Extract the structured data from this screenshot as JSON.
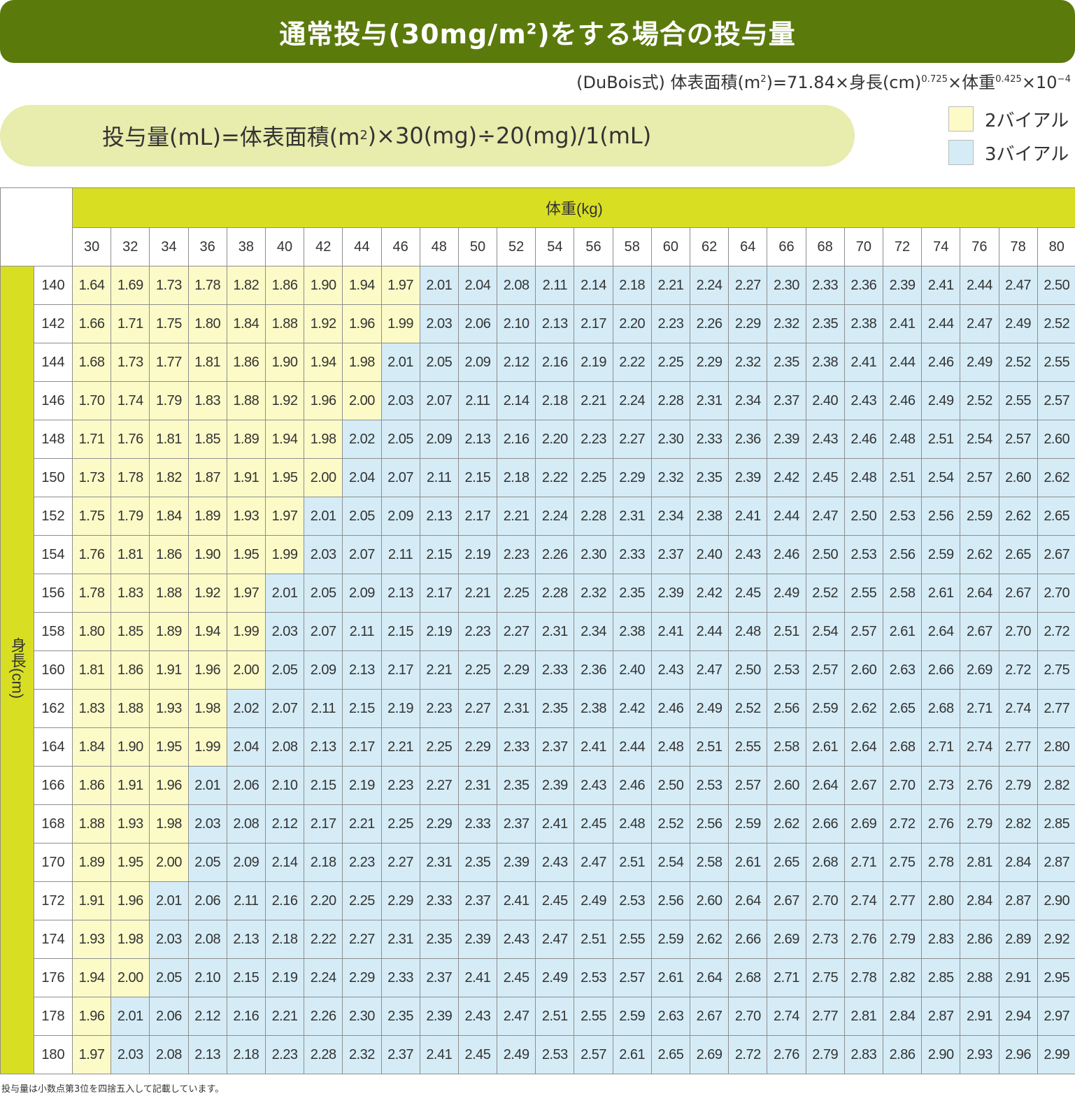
{
  "title": {
    "main": "通常投与(30mg/m",
    "sup": "2",
    "rest": ")をする場合の投与量"
  },
  "dubois": {
    "a": "(DuBois式) 体表面積(m",
    "a_sup": "2",
    "b": ")=71.84×身長(cm)",
    "b_sup": "0.725",
    "c": "×体重",
    "c_sup": "0.425",
    "d": "×10",
    "d_sup": "−4"
  },
  "formula": {
    "a": "投与量(mL)=体表面積(m",
    "a_sup": "2",
    "b": ")×30(mg)÷20(mg)/1(mL)"
  },
  "legend": [
    {
      "label": "2バイアル",
      "color": "#fcfbc8"
    },
    {
      "label": "3バイアル",
      "color": "#d5ecf6"
    }
  ],
  "table": {
    "weight_header": "体重(kg)",
    "height_header": "身長(cm)",
    "weights": [
      "30",
      "32",
      "34",
      "36",
      "38",
      "40",
      "42",
      "44",
      "46",
      "48",
      "50",
      "52",
      "54",
      "56",
      "58",
      "60",
      "62",
      "64",
      "66",
      "68",
      "70",
      "72",
      "74",
      "76",
      "78",
      "80"
    ],
    "heights": [
      "140",
      "142",
      "144",
      "146",
      "148",
      "150",
      "152",
      "154",
      "156",
      "158",
      "160",
      "162",
      "164",
      "166",
      "168",
      "170",
      "172",
      "174",
      "176",
      "178",
      "180"
    ],
    "values": [
      [
        "1.64",
        "1.69",
        "1.73",
        "1.78",
        "1.82",
        "1.86",
        "1.90",
        "1.94",
        "1.97",
        "2.01",
        "2.04",
        "2.08",
        "2.11",
        "2.14",
        "2.18",
        "2.21",
        "2.24",
        "2.27",
        "2.30",
        "2.33",
        "2.36",
        "2.39",
        "2.41",
        "2.44",
        "2.47",
        "2.50"
      ],
      [
        "1.66",
        "1.71",
        "1.75",
        "1.80",
        "1.84",
        "1.88",
        "1.92",
        "1.96",
        "1.99",
        "2.03",
        "2.06",
        "2.10",
        "2.13",
        "2.17",
        "2.20",
        "2.23",
        "2.26",
        "2.29",
        "2.32",
        "2.35",
        "2.38",
        "2.41",
        "2.44",
        "2.47",
        "2.49",
        "2.52"
      ],
      [
        "1.68",
        "1.73",
        "1.77",
        "1.81",
        "1.86",
        "1.90",
        "1.94",
        "1.98",
        "2.01",
        "2.05",
        "2.09",
        "2.12",
        "2.16",
        "2.19",
        "2.22",
        "2.25",
        "2.29",
        "2.32",
        "2.35",
        "2.38",
        "2.41",
        "2.44",
        "2.46",
        "2.49",
        "2.52",
        "2.55"
      ],
      [
        "1.70",
        "1.74",
        "1.79",
        "1.83",
        "1.88",
        "1.92",
        "1.96",
        "2.00",
        "2.03",
        "2.07",
        "2.11",
        "2.14",
        "2.18",
        "2.21",
        "2.24",
        "2.28",
        "2.31",
        "2.34",
        "2.37",
        "2.40",
        "2.43",
        "2.46",
        "2.49",
        "2.52",
        "2.55",
        "2.57"
      ],
      [
        "1.71",
        "1.76",
        "1.81",
        "1.85",
        "1.89",
        "1.94",
        "1.98",
        "2.02",
        "2.05",
        "2.09",
        "2.13",
        "2.16",
        "2.20",
        "2.23",
        "2.27",
        "2.30",
        "2.33",
        "2.36",
        "2.39",
        "2.43",
        "2.46",
        "2.48",
        "2.51",
        "2.54",
        "2.57",
        "2.60"
      ],
      [
        "1.73",
        "1.78",
        "1.82",
        "1.87",
        "1.91",
        "1.95",
        "2.00",
        "2.04",
        "2.07",
        "2.11",
        "2.15",
        "2.18",
        "2.22",
        "2.25",
        "2.29",
        "2.32",
        "2.35",
        "2.39",
        "2.42",
        "2.45",
        "2.48",
        "2.51",
        "2.54",
        "2.57",
        "2.60",
        "2.62"
      ],
      [
        "1.75",
        "1.79",
        "1.84",
        "1.89",
        "1.93",
        "1.97",
        "2.01",
        "2.05",
        "2.09",
        "2.13",
        "2.17",
        "2.21",
        "2.24",
        "2.28",
        "2.31",
        "2.34",
        "2.38",
        "2.41",
        "2.44",
        "2.47",
        "2.50",
        "2.53",
        "2.56",
        "2.59",
        "2.62",
        "2.65"
      ],
      [
        "1.76",
        "1.81",
        "1.86",
        "1.90",
        "1.95",
        "1.99",
        "2.03",
        "2.07",
        "2.11",
        "2.15",
        "2.19",
        "2.23",
        "2.26",
        "2.30",
        "2.33",
        "2.37",
        "2.40",
        "2.43",
        "2.46",
        "2.50",
        "2.53",
        "2.56",
        "2.59",
        "2.62",
        "2.65",
        "2.67"
      ],
      [
        "1.78",
        "1.83",
        "1.88",
        "1.92",
        "1.97",
        "2.01",
        "2.05",
        "2.09",
        "2.13",
        "2.17",
        "2.21",
        "2.25",
        "2.28",
        "2.32",
        "2.35",
        "2.39",
        "2.42",
        "2.45",
        "2.49",
        "2.52",
        "2.55",
        "2.58",
        "2.61",
        "2.64",
        "2.67",
        "2.70"
      ],
      [
        "1.80",
        "1.85",
        "1.89",
        "1.94",
        "1.99",
        "2.03",
        "2.07",
        "2.11",
        "2.15",
        "2.19",
        "2.23",
        "2.27",
        "2.31",
        "2.34",
        "2.38",
        "2.41",
        "2.44",
        "2.48",
        "2.51",
        "2.54",
        "2.57",
        "2.61",
        "2.64",
        "2.67",
        "2.70",
        "2.72"
      ],
      [
        "1.81",
        "1.86",
        "1.91",
        "1.96",
        "2.00",
        "2.05",
        "2.09",
        "2.13",
        "2.17",
        "2.21",
        "2.25",
        "2.29",
        "2.33",
        "2.36",
        "2.40",
        "2.43",
        "2.47",
        "2.50",
        "2.53",
        "2.57",
        "2.60",
        "2.63",
        "2.66",
        "2.69",
        "2.72",
        "2.75"
      ],
      [
        "1.83",
        "1.88",
        "1.93",
        "1.98",
        "2.02",
        "2.07",
        "2.11",
        "2.15",
        "2.19",
        "2.23",
        "2.27",
        "2.31",
        "2.35",
        "2.38",
        "2.42",
        "2.46",
        "2.49",
        "2.52",
        "2.56",
        "2.59",
        "2.62",
        "2.65",
        "2.68",
        "2.71",
        "2.74",
        "2.77"
      ],
      [
        "1.84",
        "1.90",
        "1.95",
        "1.99",
        "2.04",
        "2.08",
        "2.13",
        "2.17",
        "2.21",
        "2.25",
        "2.29",
        "2.33",
        "2.37",
        "2.41",
        "2.44",
        "2.48",
        "2.51",
        "2.55",
        "2.58",
        "2.61",
        "2.64",
        "2.68",
        "2.71",
        "2.74",
        "2.77",
        "2.80"
      ],
      [
        "1.86",
        "1.91",
        "1.96",
        "2.01",
        "2.06",
        "2.10",
        "2.15",
        "2.19",
        "2.23",
        "2.27",
        "2.31",
        "2.35",
        "2.39",
        "2.43",
        "2.46",
        "2.50",
        "2.53",
        "2.57",
        "2.60",
        "2.64",
        "2.67",
        "2.70",
        "2.73",
        "2.76",
        "2.79",
        "2.82"
      ],
      [
        "1.88",
        "1.93",
        "1.98",
        "2.03",
        "2.08",
        "2.12",
        "2.17",
        "2.21",
        "2.25",
        "2.29",
        "2.33",
        "2.37",
        "2.41",
        "2.45",
        "2.48",
        "2.52",
        "2.56",
        "2.59",
        "2.62",
        "2.66",
        "2.69",
        "2.72",
        "2.76",
        "2.79",
        "2.82",
        "2.85"
      ],
      [
        "1.89",
        "1.95",
        "2.00",
        "2.05",
        "2.09",
        "2.14",
        "2.18",
        "2.23",
        "2.27",
        "2.31",
        "2.35",
        "2.39",
        "2.43",
        "2.47",
        "2.51",
        "2.54",
        "2.58",
        "2.61",
        "2.65",
        "2.68",
        "2.71",
        "2.75",
        "2.78",
        "2.81",
        "2.84",
        "2.87"
      ],
      [
        "1.91",
        "1.96",
        "2.01",
        "2.06",
        "2.11",
        "2.16",
        "2.20",
        "2.25",
        "2.29",
        "2.33",
        "2.37",
        "2.41",
        "2.45",
        "2.49",
        "2.53",
        "2.56",
        "2.60",
        "2.64",
        "2.67",
        "2.70",
        "2.74",
        "2.77",
        "2.80",
        "2.84",
        "2.87",
        "2.90"
      ],
      [
        "1.93",
        "1.98",
        "2.03",
        "2.08",
        "2.13",
        "2.18",
        "2.22",
        "2.27",
        "2.31",
        "2.35",
        "2.39",
        "2.43",
        "2.47",
        "2.51",
        "2.55",
        "2.59",
        "2.62",
        "2.66",
        "2.69",
        "2.73",
        "2.76",
        "2.79",
        "2.83",
        "2.86",
        "2.89",
        "2.92"
      ],
      [
        "1.94",
        "2.00",
        "2.05",
        "2.10",
        "2.15",
        "2.19",
        "2.24",
        "2.29",
        "2.33",
        "2.37",
        "2.41",
        "2.45",
        "2.49",
        "2.53",
        "2.57",
        "2.61",
        "2.64",
        "2.68",
        "2.71",
        "2.75",
        "2.78",
        "2.82",
        "2.85",
        "2.88",
        "2.91",
        "2.95"
      ],
      [
        "1.96",
        "2.01",
        "2.06",
        "2.12",
        "2.16",
        "2.21",
        "2.26",
        "2.30",
        "2.35",
        "2.39",
        "2.43",
        "2.47",
        "2.51",
        "2.55",
        "2.59",
        "2.63",
        "2.67",
        "2.70",
        "2.74",
        "2.77",
        "2.81",
        "2.84",
        "2.87",
        "2.91",
        "2.94",
        "2.97"
      ],
      [
        "1.97",
        "2.03",
        "2.08",
        "2.13",
        "2.18",
        "2.23",
        "2.28",
        "2.32",
        "2.37",
        "2.41",
        "2.45",
        "2.49",
        "2.53",
        "2.57",
        "2.61",
        "2.65",
        "2.69",
        "2.72",
        "2.76",
        "2.79",
        "2.83",
        "2.86",
        "2.90",
        "2.93",
        "2.96",
        "2.99"
      ]
    ]
  },
  "note": "投与量は小数点第3位を四捨五入して記載しています。"
}
